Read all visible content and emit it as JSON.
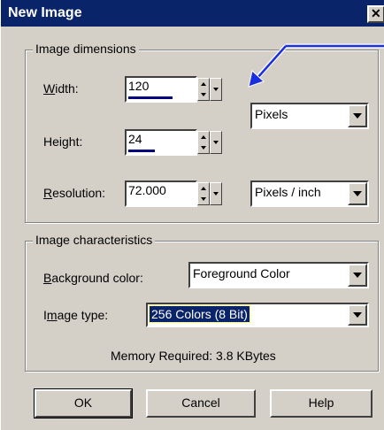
{
  "window": {
    "title": "New Image",
    "close_label": "✕"
  },
  "dimensions": {
    "group_label": "Image dimensions",
    "width": {
      "label": "Width:",
      "value": "120"
    },
    "height": {
      "label": "Height:",
      "value": "24"
    },
    "resolution": {
      "label": "Resolution:",
      "value": "72.000"
    },
    "units": {
      "value": "Pixels"
    },
    "resolution_units": {
      "value": "Pixels / inch"
    }
  },
  "characteristics": {
    "group_label": "Image characteristics",
    "background": {
      "label": "Background color:",
      "value": "Foreground Color"
    },
    "image_type": {
      "label": "Image type:",
      "value": "256 Colors (8 Bit)"
    },
    "memory": "Memory Required: 3.8 KBytes"
  },
  "buttons": {
    "ok": "OK",
    "cancel": "Cancel",
    "help": "Help"
  },
  "colors": {
    "title_bar": "#0a246a",
    "dialog": "#d4d0c8",
    "annotation_arrow": "#1a2fe0"
  },
  "icons": [
    "close-icon",
    "spin-up-icon",
    "spin-down-icon",
    "dropdown-arrow-icon",
    "annotation-arrow-icon"
  ]
}
